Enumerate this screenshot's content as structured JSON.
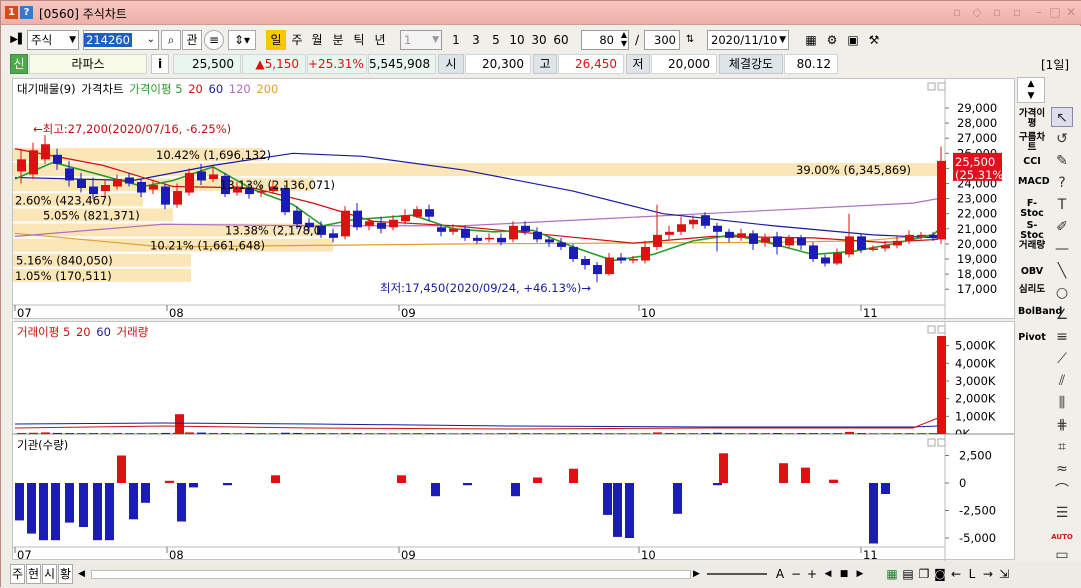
{
  "window": {
    "badge_1": "1",
    "badge_2": "?",
    "title": "[0560] 주식차트"
  },
  "toolbar": {
    "market_select": "주식",
    "code_input": "214260",
    "rel_btn": "관",
    "period_buttons": [
      "일",
      "주",
      "월",
      "분",
      "틱",
      "년"
    ],
    "interval_select": "1",
    "count_buttons": [
      "1",
      "3",
      "5",
      "10",
      "30",
      "60"
    ],
    "view_count": "80",
    "divider": "/",
    "total_count": "300",
    "date": "2020/11/10"
  },
  "quote": {
    "badge": "신",
    "name": "라파스",
    "info_btn": "i",
    "price": "25,500",
    "change": "▲5,150",
    "rate": "+25.31%",
    "volume": "5,545,908",
    "open_label": "시",
    "open": "20,300",
    "high_label": "고",
    "high": "26,450",
    "low_label": "저",
    "low": "20,000",
    "strength_label": "체결강도",
    "strength": "80.12",
    "period_tag": "[1일]"
  },
  "chart_data": [
    {
      "type": "candlestick",
      "legend": [
        "대기매물(9)",
        "가격차트",
        "가격이평 5",
        "20",
        "60",
        "120",
        "200"
      ],
      "legend_colors": [
        "#000000",
        "#000000",
        "#2c9a2c",
        "#cc1111",
        "#1a1aa0",
        "#b070c0",
        "#e0a030"
      ],
      "y_ticks": [
        "29,000",
        "28,000",
        "27,000",
        "26,000",
        "25,000",
        "24,000",
        "23,000",
        "22,000",
        "21,000",
        "20,000",
        "19,000",
        "18,000",
        "17,000"
      ],
      "x_labels": [
        "07",
        "08",
        "09",
        "10",
        "11"
      ],
      "price_label": "25,500",
      "price_rate_label": "(25.31%)",
      "volume_profile": [
        {
          "label": "1.05% (170,511)",
          "share": 0.0105
        },
        {
          "label": "5.16% (840,050)",
          "share": 0.0516
        },
        {
          "label": "10.21% (1,661,648)",
          "share": 0.1021
        },
        {
          "label": "13.38% (2,178,0",
          "share": 0.1338
        },
        {
          "label": "5.05% (821,371)",
          "share": 0.0505
        },
        {
          "label": "2.60% (423,467)",
          "share": 0.026
        },
        {
          "label": "13.13% (2,136,071)",
          "share": 0.1313
        },
        {
          "label": "39.00% (6,345,869)",
          "share": 0.39
        },
        {
          "label": "10.42% (1,696,132)",
          "share": 0.1042
        }
      ],
      "high_annotation": "←최고:27,200(2020/07/16, -6.25%)",
      "low_annotation": "최저:17,450(2020/09/24, +46.13%)→"
    },
    {
      "type": "bar",
      "legend": [
        "거래이평 5",
        "20",
        "60",
        "거래량"
      ],
      "legend_colors": [
        "#cc1111",
        "#cc1111",
        "#1a1aa0",
        "#cc1111"
      ],
      "y_ticks": [
        "5,000K",
        "4,000K",
        "3,000K",
        "2,000K",
        "1,000K",
        "0K"
      ]
    },
    {
      "type": "bar",
      "legend": [
        "기관(수량)"
      ],
      "y_ticks": [
        "2,500",
        "0",
        "-2,500",
        "-5,000"
      ],
      "x_labels": [
        "07",
        "08",
        "09",
        "10",
        "11"
      ]
    }
  ],
  "sidebar": {
    "indicators": [
      "가격이평",
      "구름차트",
      "CCI",
      "MACD",
      "F-Stoc",
      "S-Stoc",
      "거래량",
      "OBV",
      "심리도",
      "BolBand",
      "Pivot"
    ]
  },
  "bottombar": {
    "tabs": [
      "주",
      "현",
      "시",
      "황"
    ],
    "auto_label": "AUTO"
  },
  "colors": {
    "up": "#dd1111",
    "down": "#1b1bb8",
    "profile": "#fbe6b8",
    "ma5": "#2c9a2c",
    "ma20": "#cc1111",
    "ma60": "#1a1aa0",
    "ma120": "#b070c0",
    "ma200": "#e0a030"
  }
}
